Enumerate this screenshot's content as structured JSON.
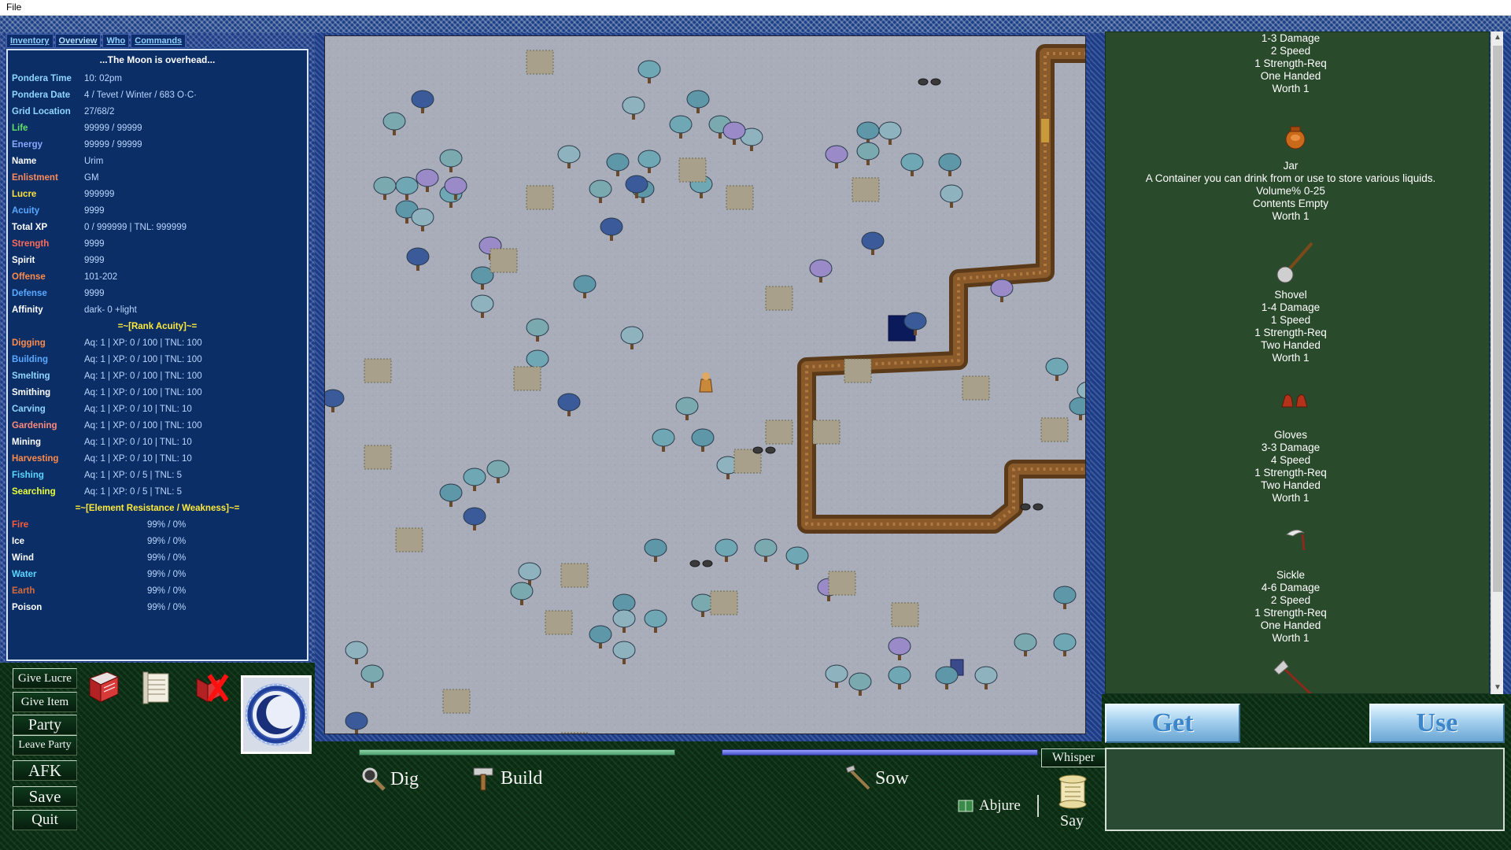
{
  "menubar": {
    "file": "File"
  },
  "tabs": [
    "Inventory",
    "Overview",
    "Who",
    "Commands"
  ],
  "stats": {
    "moon": "...The Moon is overhead...",
    "rows": [
      {
        "label": "Pondera Time",
        "value": "10: 02pm",
        "color": "#8fd6ff"
      },
      {
        "label": "Pondera Date",
        "value": "4 / Tevet / Winter / 683 O·C·",
        "color": "#8fd6ff"
      },
      {
        "label": "Grid Location",
        "value": "27/68/2",
        "color": "#8fd6ff"
      },
      {
        "label": "Life",
        "value": "99999 / 99999",
        "color": "#63e06a"
      },
      {
        "label": "Energy",
        "value": "99999 / 99999",
        "color": "#8aa6ff"
      },
      {
        "label": "Name",
        "value": "Urim",
        "color": "#ffffff"
      },
      {
        "label": "Enlistment",
        "value": "GM",
        "color": "#ff8a5a"
      },
      {
        "label": "Lucre",
        "value": "999999",
        "color": "#ffe23a"
      },
      {
        "label": "Acuity",
        "value": "9999",
        "color": "#5aa8ff"
      },
      {
        "label": "Total XP",
        "value": "0 / 999999 | TNL: 999999",
        "color": "#ffffff"
      },
      {
        "label": "Strength",
        "value": "9999",
        "color": "#ff6a5a"
      },
      {
        "label": "Spirit",
        "value": "9999",
        "color": "#ffffff"
      },
      {
        "label": "Offense",
        "value": "101-202",
        "color": "#ff8a4a"
      },
      {
        "label": "Defense",
        "value": "9999",
        "color": "#5aa8ff"
      },
      {
        "label": "Affinity",
        "value": "dark-  0  +light",
        "color": "#ffffff"
      }
    ],
    "rank_header": "=~[Rank Acuity]~=",
    "skills": [
      {
        "label": "Digging",
        "value": "Aq: 1 | XP: 0 / 100 | TNL: 100",
        "color": "#ff8a4a"
      },
      {
        "label": "Building",
        "value": "Aq: 1 | XP: 0 / 100 | TNL: 100",
        "color": "#5aa8ff"
      },
      {
        "label": "Smelting",
        "value": "Aq: 1 | XP: 0 / 100 | TNL: 100",
        "color": "#8fd6ff"
      },
      {
        "label": "Smithing",
        "value": "Aq: 1 | XP: 0 / 100 | TNL: 100",
        "color": "#ffffff"
      },
      {
        "label": "Carving",
        "value": "Aq: 1 | XP: 0 / 10 | TNL: 10",
        "color": "#8fd6ff"
      },
      {
        "label": "Gardening",
        "value": "Aq: 1 | XP: 0 / 100 | TNL: 100",
        "color": "#ff8a7a"
      },
      {
        "label": "Mining",
        "value": "Aq: 1 | XP: 0 / 10 | TNL: 10",
        "color": "#ffffff"
      },
      {
        "label": "Harvesting",
        "value": "Aq: 1 | XP: 0 / 10 | TNL: 10",
        "color": "#ff8a4a"
      },
      {
        "label": "Fishing",
        "value": "Aq: 1 | XP: 0 / 5 | TNL: 5",
        "color": "#5ad6ff"
      },
      {
        "label": "Searching",
        "value": "Aq: 1 | XP: 0 / 5 | TNL: 5",
        "color": "#e8ff3a"
      }
    ],
    "element_header": "=~[Element Resistance / Weakness]~=",
    "elements": [
      {
        "label": "Fire",
        "value": "99% / 0%",
        "color": "#ff5a3a"
      },
      {
        "label": "Ice",
        "value": "99% / 0%",
        "color": "#ffffff"
      },
      {
        "label": "Wind",
        "value": "99% / 0%",
        "color": "#ffffff"
      },
      {
        "label": "Water",
        "value": "99% / 0%",
        "color": "#5ad6ff"
      },
      {
        "label": "Earth",
        "value": "99% / 0%",
        "color": "#d46a3a"
      },
      {
        "label": "Poison",
        "value": "99% / 0%",
        "color": "#ffffff"
      }
    ]
  },
  "left_buttons": {
    "give_lucre": "Give Lucre",
    "give_item": "Give Item",
    "party": "Party",
    "leave_party": "Leave Party",
    "afk": "AFK",
    "save": "Save",
    "quit": "Quit"
  },
  "actions": {
    "dig": "Dig",
    "build": "Build",
    "sow": "Sow",
    "abjure": "Abjure",
    "whisper": "Whisper",
    "say": "Say"
  },
  "items": [
    {
      "lines": [
        "1-3 Damage",
        "2 Speed",
        "1 Strength-Req",
        "One Handed",
        "Worth 1"
      ],
      "icon": "none"
    },
    {
      "lines": [
        "Jar",
        "A Container you can drink from or use to store various liquids.",
        "Volume% 0-25",
        "Contents Empty",
        "Worth 1"
      ],
      "icon": "jar-icon"
    },
    {
      "lines": [
        "Shovel",
        "1-4 Damage",
        "1 Speed",
        "1 Strength-Req",
        "Two Handed",
        "Worth 1"
      ],
      "icon": "shovel-icon"
    },
    {
      "lines": [
        "Gloves",
        "3-3 Damage",
        "4 Speed",
        "1 Strength-Req",
        "Two Handed",
        "Worth 1"
      ],
      "icon": "gloves-icon"
    },
    {
      "lines": [
        "Sickle",
        "4-6 Damage",
        "2 Speed",
        "1 Strength-Req",
        "One Handed",
        "Worth 1"
      ],
      "icon": "sickle-icon"
    }
  ],
  "item_buttons": {
    "get": "Get",
    "use": "Use"
  }
}
